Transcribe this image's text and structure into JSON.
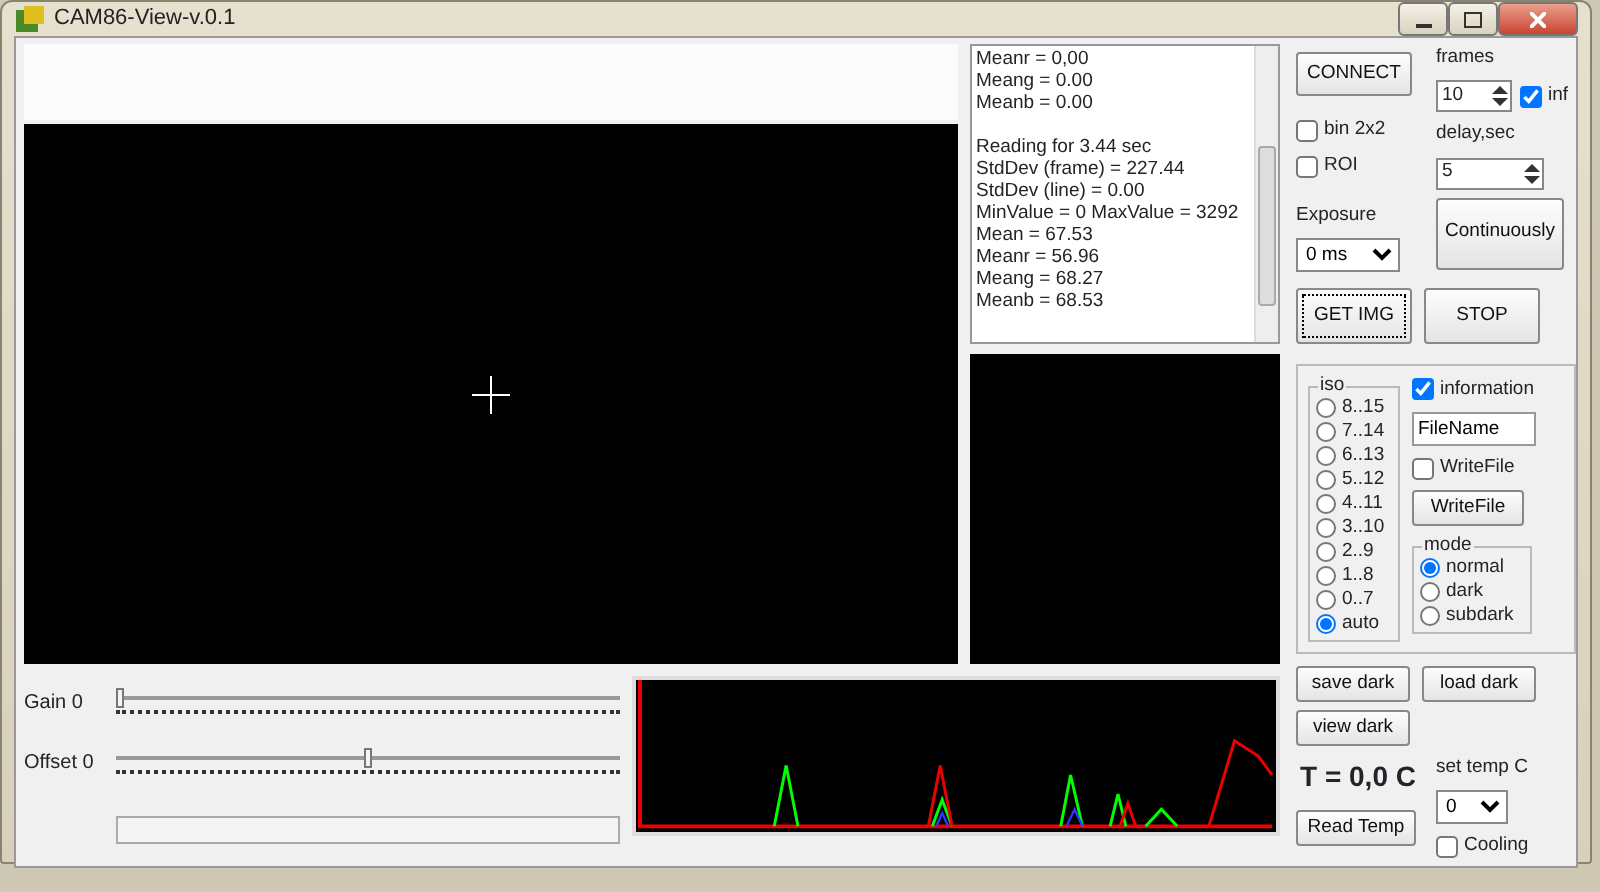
{
  "window": {
    "title": "CAM86-View-v.0.1"
  },
  "log": [
    [
      "Meanr = 0,00",
      "Meang = 0.00",
      "Meanb = 0.00"
    ],
    [
      "Reading for 3.44 sec",
      "StdDev (frame) = 227.44",
      "StdDev (line) = 0.00",
      "MinValue = 0 MaxValue = 3292",
      "Mean = 67.53",
      "Meanr = 56.96",
      "Meang = 68.27",
      "Meanb = 68.53"
    ]
  ],
  "sliders": [
    {
      "label": "Gain 0",
      "level": 0
    },
    {
      "label": "Offset 0",
      "level": 0.5
    }
  ],
  "progress": {
    "level": 0
  },
  "connect_button": "CONNECT",
  "frames": {
    "label": "frames",
    "value": "10"
  },
  "inf": {
    "label": "inf",
    "checked": true
  },
  "bin": {
    "label": "bin 2x2",
    "checked": false
  },
  "roi": {
    "label": "ROI",
    "checked": false
  },
  "delay": {
    "label": "delay,sec",
    "value": "5"
  },
  "exposure": {
    "label": "Exposure",
    "value": "0 ms"
  },
  "continuous_button": "Continuously",
  "get_button": "GET IMG",
  "stop_button": "STOP",
  "iso": {
    "label": "iso",
    "options": [
      {
        "label": "8..15",
        "selected": false
      },
      {
        "label": "7..14",
        "selected": false
      },
      {
        "label": "6..13",
        "selected": false
      },
      {
        "label": "5..12",
        "selected": false
      },
      {
        "label": "4..11",
        "selected": false
      },
      {
        "label": "3..10",
        "selected": false
      },
      {
        "label": "2..9",
        "selected": false
      },
      {
        "label": "1..8",
        "selected": false
      },
      {
        "label": "0..7",
        "selected": false
      },
      {
        "label": "auto",
        "selected": true
      }
    ]
  },
  "information": {
    "label": "information",
    "checked": true
  },
  "filename": {
    "value": "FileName"
  },
  "writefile_check": {
    "label": "WriteFile",
    "checked": false
  },
  "writefile_button": "WriteFile",
  "mode": {
    "label": "mode",
    "options": [
      {
        "label": "normal",
        "selected": true
      },
      {
        "label": "dark",
        "selected": false
      },
      {
        "label": "subdark",
        "selected": false
      }
    ]
  },
  "save_dark_button": "save dark",
  "load_dark_button": "load dark",
  "view_dark_button": "view dark",
  "temperature": "T = 0,0 C",
  "read_temp_button": "Read Temp",
  "set_temp": {
    "label": "set temp C",
    "value": "0"
  },
  "cooling": {
    "label": "Cooling",
    "checked": false
  }
}
